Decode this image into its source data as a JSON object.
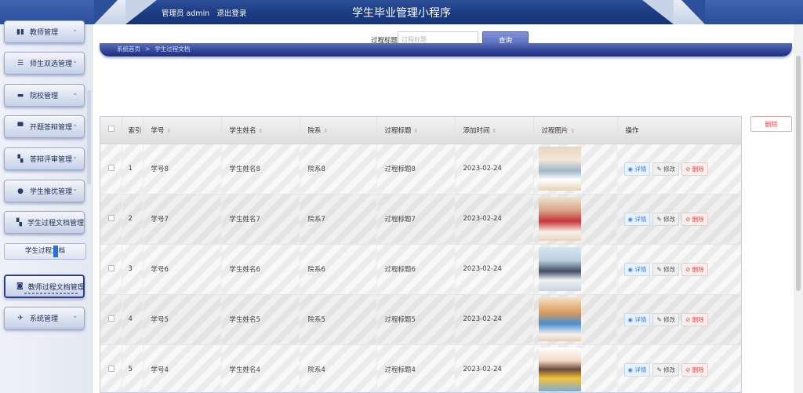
{
  "header": {
    "admin_label": "管理员 admin",
    "logout_label": "退出登录",
    "app_title": "学生毕业管理小程序"
  },
  "sidebar": {
    "items": [
      {
        "label": "教师管理",
        "icon": "chart-icon",
        "glyph": "▮▮"
      },
      {
        "label": "师生双选管理",
        "icon": "list-icon",
        "glyph": "☰"
      },
      {
        "label": "院校管理",
        "icon": "chat-icon",
        "glyph": "▬"
      },
      {
        "label": "开题答辩管理",
        "icon": "monitor-icon",
        "glyph": "▀"
      },
      {
        "label": "答辩评审管理",
        "icon": "grid-icon",
        "glyph": "▚"
      },
      {
        "label": "学生推优管理",
        "icon": "user-icon",
        "glyph": "●"
      },
      {
        "label": "学生过程文档管理",
        "icon": "grid-icon",
        "glyph": "▚"
      },
      {
        "label": "教师过程文档管理",
        "icon": "doc-icon",
        "glyph": "◙"
      },
      {
        "label": "系统管理",
        "icon": "send-icon",
        "glyph": "✈"
      }
    ],
    "sub_item": "学生过程文档",
    "chevron": "⌄"
  },
  "search": {
    "label": "过程标题",
    "placeholder": "过程标题",
    "button": "查询"
  },
  "breadcrumb": {
    "home": "系统首页",
    "sep": ">",
    "current": "学生过程文档"
  },
  "toolbar": {
    "delete_label": "删除"
  },
  "table": {
    "headers": [
      "索引",
      "学号",
      "学生姓名",
      "院系",
      "过程标题",
      "添加时间",
      "过程图片",
      "操作"
    ],
    "rows": [
      {
        "index": "1",
        "student_id": "学号8",
        "name": "学生姓名8",
        "dept": "院系8",
        "title": "过程标题8",
        "time": "2023-02-24"
      },
      {
        "index": "2",
        "student_id": "学号7",
        "name": "学生姓名7",
        "dept": "院系7",
        "title": "过程标题7",
        "time": "2023-02-24"
      },
      {
        "index": "3",
        "student_id": "学号6",
        "name": "学生姓名6",
        "dept": "院系6",
        "title": "过程标题6",
        "time": "2023-02-24"
      },
      {
        "index": "4",
        "student_id": "学号5",
        "name": "学生姓名5",
        "dept": "院系5",
        "title": "过程标题5",
        "time": "2023-02-24"
      },
      {
        "index": "5",
        "student_id": "学号4",
        "name": "学生姓名4",
        "dept": "院系4",
        "title": "过程标题4",
        "time": "2023-02-24"
      }
    ],
    "actions": {
      "detail": "◉ 详情",
      "edit": "✎ 修改",
      "delete": "⊘ 删除"
    }
  }
}
